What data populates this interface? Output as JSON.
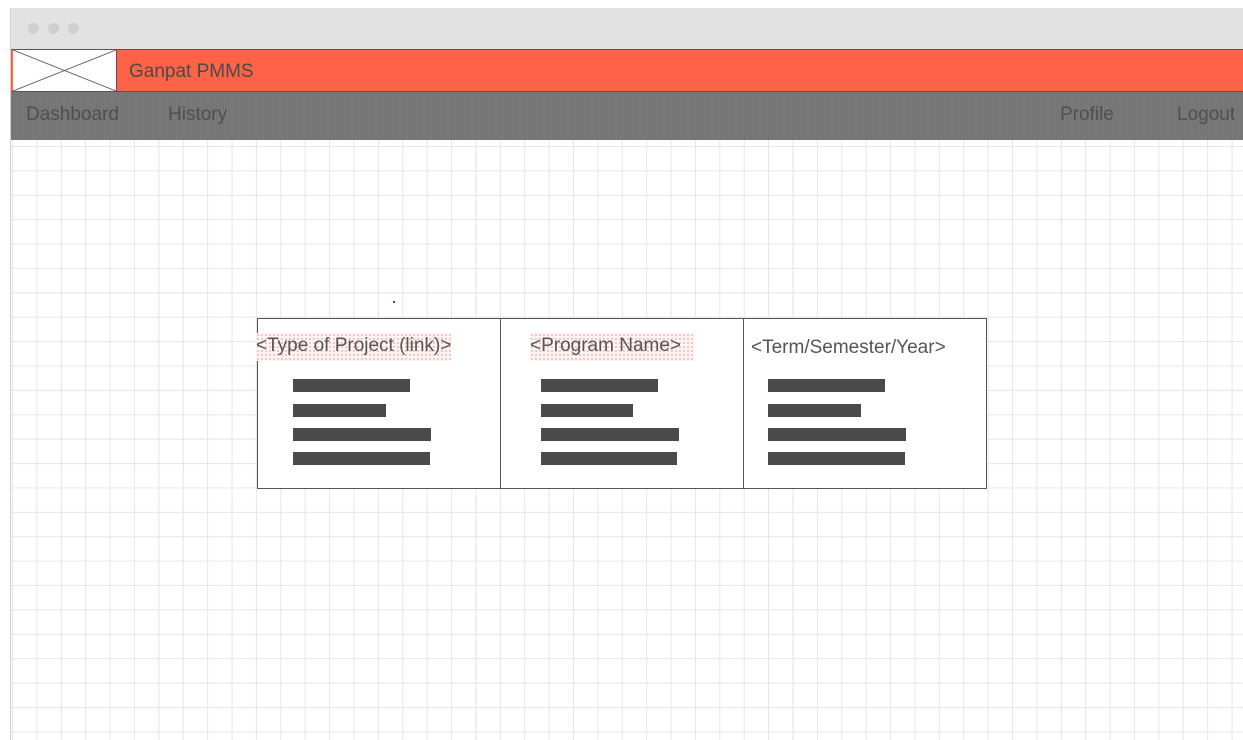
{
  "window": {
    "controls": [
      "close-dot",
      "minimize-dot",
      "maximize-dot"
    ]
  },
  "header": {
    "logo_icon": "image-placeholder-icon",
    "app_title": "Ganpat PMMS",
    "background_color": "#ff6347"
  },
  "nav": {
    "left": [
      {
        "label": "Dashboard"
      },
      {
        "label": "History"
      }
    ],
    "right": [
      {
        "label": "Profile"
      },
      {
        "label": "Logout"
      }
    ],
    "background_color": "#757575"
  },
  "cards": [
    {
      "title": "<Type of Project (link)>",
      "is_link": true,
      "bar_fill": [
        0.85,
        0.67,
        1.0,
        0.99
      ]
    },
    {
      "title": "<Program Name>",
      "is_link": true,
      "bar_fill": [
        0.85,
        0.67,
        1.0,
        0.99
      ]
    },
    {
      "title": "<Term/Semester/Year>",
      "is_link": false,
      "bar_fill": [
        0.85,
        0.67,
        1.0,
        0.99
      ]
    }
  ]
}
